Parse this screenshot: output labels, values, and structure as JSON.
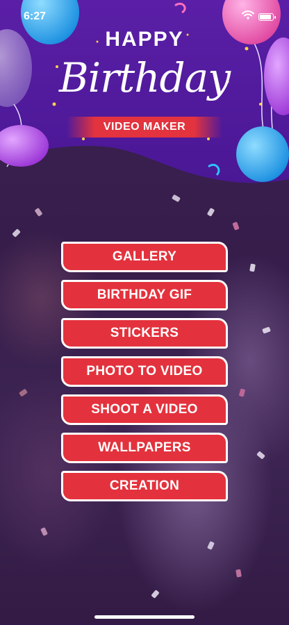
{
  "status_bar": {
    "time": "6:27",
    "battery_level": 1.0
  },
  "header": {
    "title_line1": "HAPPY",
    "title_line2": "Birthday",
    "subtitle": "VIDEO MAKER",
    "background_color": "#5a1fa6",
    "balloon_colors": [
      "#2aa7ee",
      "#e95ab8",
      "#a241e0"
    ]
  },
  "menu": {
    "button_color": "#e3323d",
    "items": [
      {
        "label": "GALLERY"
      },
      {
        "label": "BIRTHDAY GIF"
      },
      {
        "label": "STICKERS"
      },
      {
        "label": "PHOTO TO VIDEO"
      },
      {
        "label": "SHOOT A VIDEO"
      },
      {
        "label": "WALLPAPERS"
      },
      {
        "label": "CREATION"
      }
    ]
  },
  "icons": [
    "wifi-icon",
    "battery-icon"
  ]
}
